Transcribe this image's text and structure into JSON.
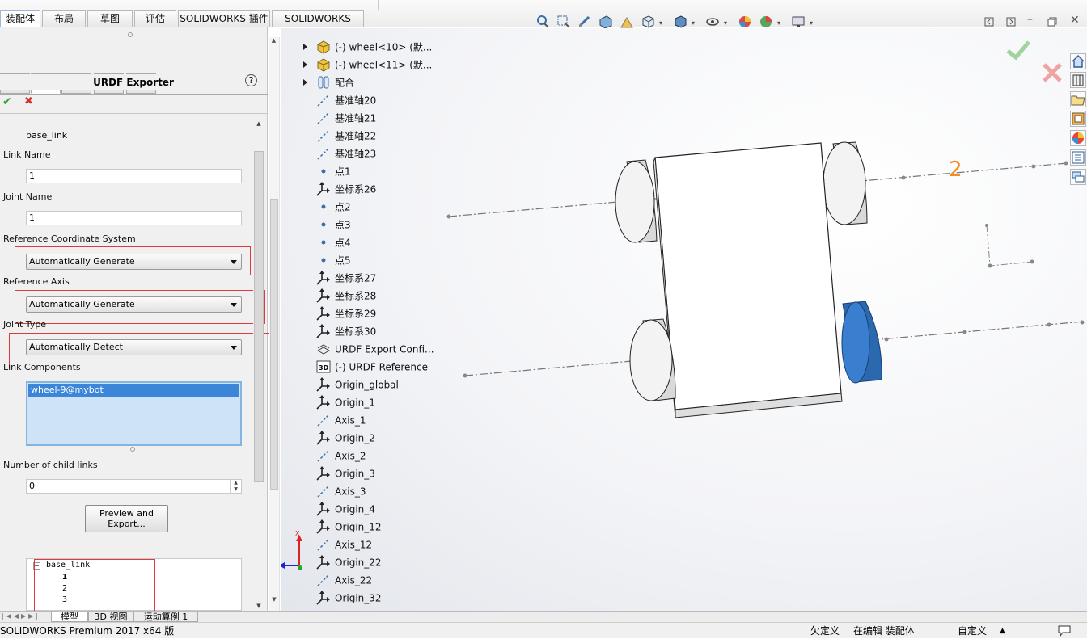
{
  "tabs": [
    {
      "label": "装配体",
      "active": true
    },
    {
      "label": "布局"
    },
    {
      "label": "草图"
    },
    {
      "label": "评估"
    },
    {
      "label": "SOLIDWORKS 插件"
    },
    {
      "label": "SOLIDWORKS MBD"
    }
  ],
  "panel": {
    "title": "URDF Exporter",
    "help": "?",
    "ok": "✔",
    "cancel": "✖",
    "parent_link_value": "base_link",
    "link_name_label": "Link Name",
    "link_name_value": "1",
    "joint_name_label": "Joint Name",
    "joint_name_value": "1",
    "ref_coord_label": "Reference Coordinate System",
    "ref_coord_value": "Automatically Generate",
    "ref_axis_label": "Reference Axis",
    "ref_axis_value": "Automatically Generate",
    "joint_type_label": "Joint Type",
    "joint_type_value": "Automatically Detect",
    "link_components_label": "Link Components",
    "link_component_item": "wheel-9@mybot",
    "child_links_label": "Number of child links",
    "child_links_value": "0",
    "preview_button_line1": "Preview and",
    "preview_button_line2": "Export...",
    "link_tree": {
      "root": "base_link",
      "children": [
        "1",
        "2",
        "3"
      ]
    }
  },
  "feature_tree": [
    {
      "label": "(-) wheel<10> (默...",
      "icon": "part-icon",
      "expand": true
    },
    {
      "label": "(-) wheel<11> (默...",
      "icon": "part-icon",
      "expand": true
    },
    {
      "label": "配合",
      "icon": "mates-icon",
      "expand": true
    },
    {
      "label": "基准轴20",
      "icon": "axis-icon"
    },
    {
      "label": "基准轴21",
      "icon": "axis-icon"
    },
    {
      "label": "基准轴22",
      "icon": "axis-icon"
    },
    {
      "label": "基准轴23",
      "icon": "axis-icon"
    },
    {
      "label": "点1",
      "icon": "point-icon"
    },
    {
      "label": "坐标系26",
      "icon": "coordinate-system-icon"
    },
    {
      "label": "点2",
      "icon": "point-icon"
    },
    {
      "label": "点3",
      "icon": "point-icon"
    },
    {
      "label": "点4",
      "icon": "point-icon"
    },
    {
      "label": "点5",
      "icon": "point-icon"
    },
    {
      "label": "坐标系27",
      "icon": "coordinate-system-icon"
    },
    {
      "label": "坐标系28",
      "icon": "coordinate-system-icon"
    },
    {
      "label": "坐标系29",
      "icon": "coordinate-system-icon"
    },
    {
      "label": "坐标系30",
      "icon": "coordinate-system-icon"
    },
    {
      "label": "URDF Export Confi...",
      "icon": "urdf-config-icon"
    },
    {
      "label": "(-) URDF Reference",
      "icon": "3d-sketch-icon"
    },
    {
      "label": "Origin_global",
      "icon": "coordinate-system-icon"
    },
    {
      "label": "Origin_1",
      "icon": "coordinate-system-icon"
    },
    {
      "label": "Axis_1",
      "icon": "axis-icon"
    },
    {
      "label": "Origin_2",
      "icon": "coordinate-system-icon"
    },
    {
      "label": "Axis_2",
      "icon": "axis-icon"
    },
    {
      "label": "Origin_3",
      "icon": "coordinate-system-icon"
    },
    {
      "label": "Axis_3",
      "icon": "axis-icon"
    },
    {
      "label": "Origin_4",
      "icon": "coordinate-system-icon"
    },
    {
      "label": "Origin_12",
      "icon": "coordinate-system-icon"
    },
    {
      "label": "Axis_12",
      "icon": "axis-icon"
    },
    {
      "label": "Origin_22",
      "icon": "coordinate-system-icon"
    },
    {
      "label": "Axis_22",
      "icon": "axis-icon"
    },
    {
      "label": "Origin_32",
      "icon": "coordinate-system-icon"
    }
  ],
  "viewport": {
    "annotation": "2",
    "triad_label_x": "X"
  },
  "bottom_tabs": [
    "模型",
    "3D 视图",
    "运动算例 1"
  ],
  "status": {
    "app": "SOLIDWORKS Premium 2017 x64 版",
    "undefined": "欠定义",
    "editing": "在编辑 装配体",
    "custom": "自定义"
  },
  "colors": {
    "accent": "#2f6fd0",
    "selected_wheel": "#3a7fcf",
    "highlight_box": "#e0393b",
    "confirm_green": "#3aa33a"
  }
}
